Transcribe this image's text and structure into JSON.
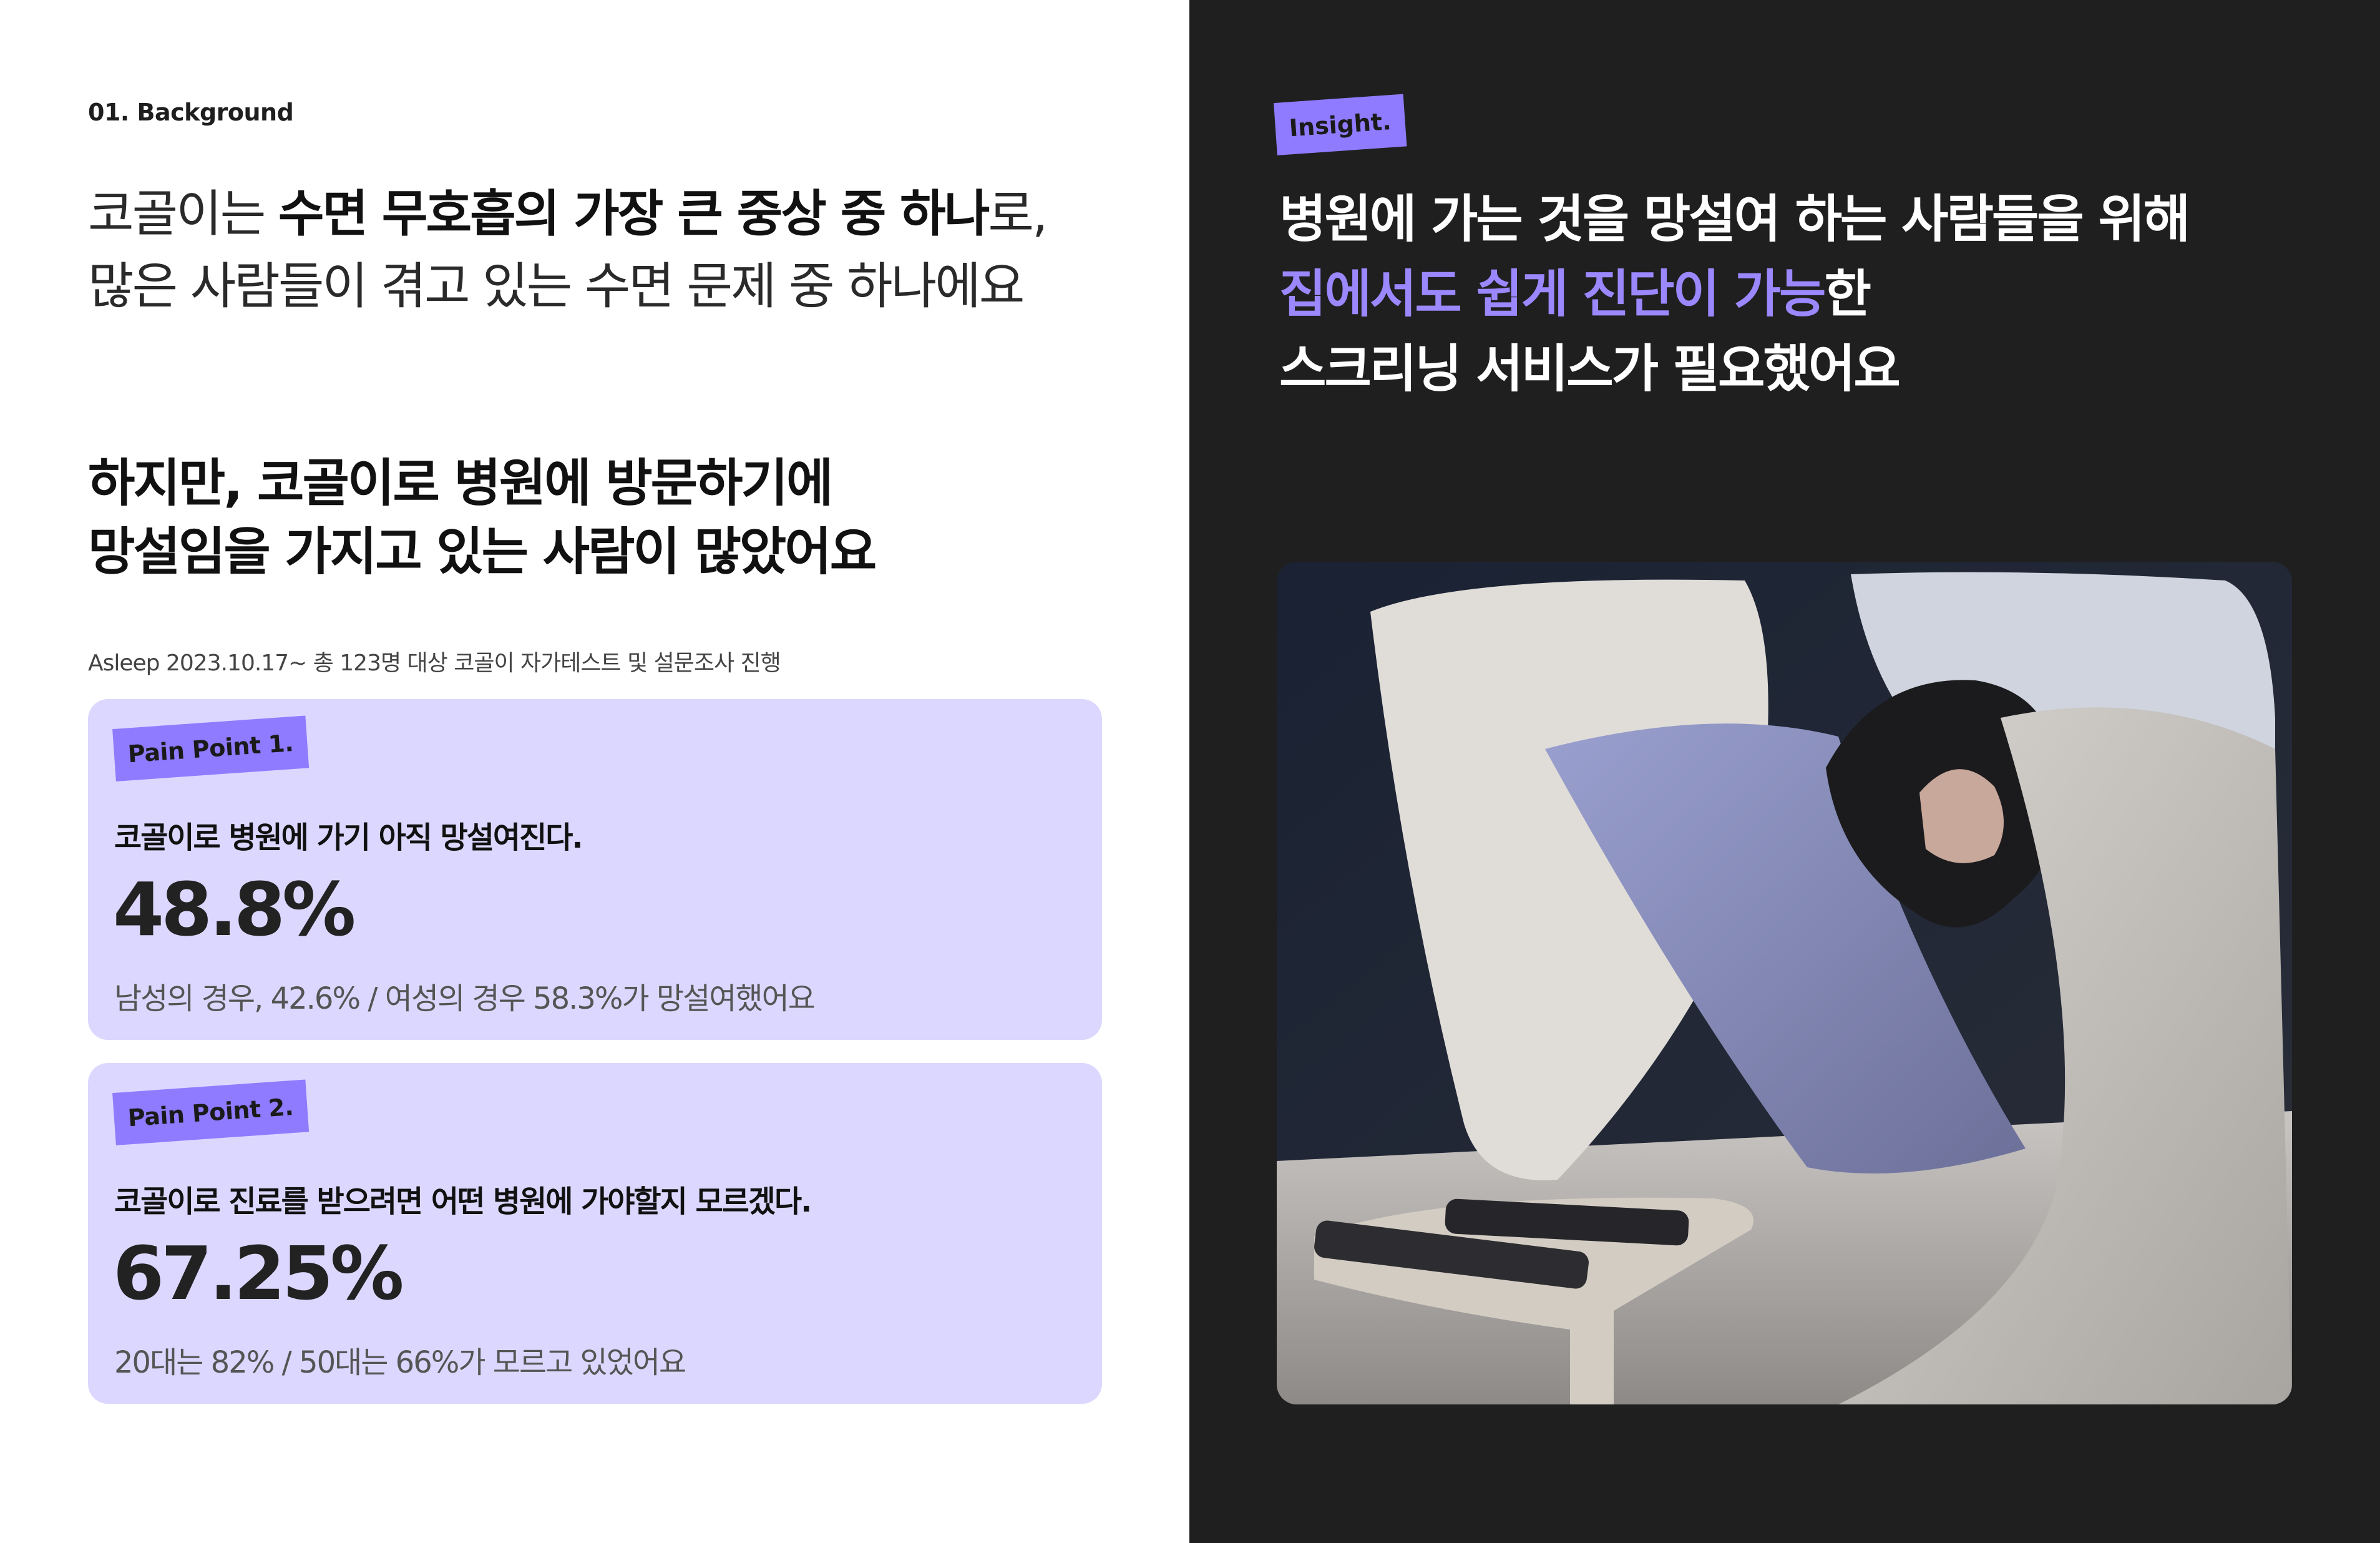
{
  "left": {
    "section_label": "01. Background",
    "intro": {
      "line1_pre": "코골이는 ",
      "line1_bold": "수면 무호흡의 가장 큰 중상 중 하나",
      "line1_post": "로,",
      "line2": "많은 사람들이 겪고 있는 수면 문제 중 하나에요"
    },
    "but": {
      "line1": "하지만,  코골이로 병원에 방문하기에",
      "line2": "망설임을 가지고 있는 사람이 많았어요"
    },
    "source": "Asleep 2023.10.17~ 총 123명 대상 코골이 자가테스트 및 설문조사 진행",
    "cards": [
      {
        "tag": "Pain Point 1.",
        "question": "코골이로 병원에 가기 아직 망설여진다.",
        "stat": "48.8%",
        "detail": "남성의 경우, 42.6% / 여성의 경우 58.3%가 망설여했어요"
      },
      {
        "tag": "Pain Point 2.",
        "question": "코골이로 진료를 받으려면 어떤 병원에 가야할지 모르겠다.",
        "stat": "67.25%",
        "detail": "20대는 82% / 50대는 66%가 모르고 있었어요"
      }
    ]
  },
  "right": {
    "tag": "Insight.",
    "line1": "병원에 가는 것을 망설여 하는 사람들을 위해",
    "line2_highlight": "집에서도 쉽게 진단이 가능",
    "line2_post": "한",
    "line3": "스크리닝 서비스가 필요했어요"
  },
  "colors": {
    "accent": "#8f7bff",
    "card_bg": "#dcd7ff",
    "dark_bg": "#1f1f1f",
    "highlight_text": "#9b88ff"
  }
}
